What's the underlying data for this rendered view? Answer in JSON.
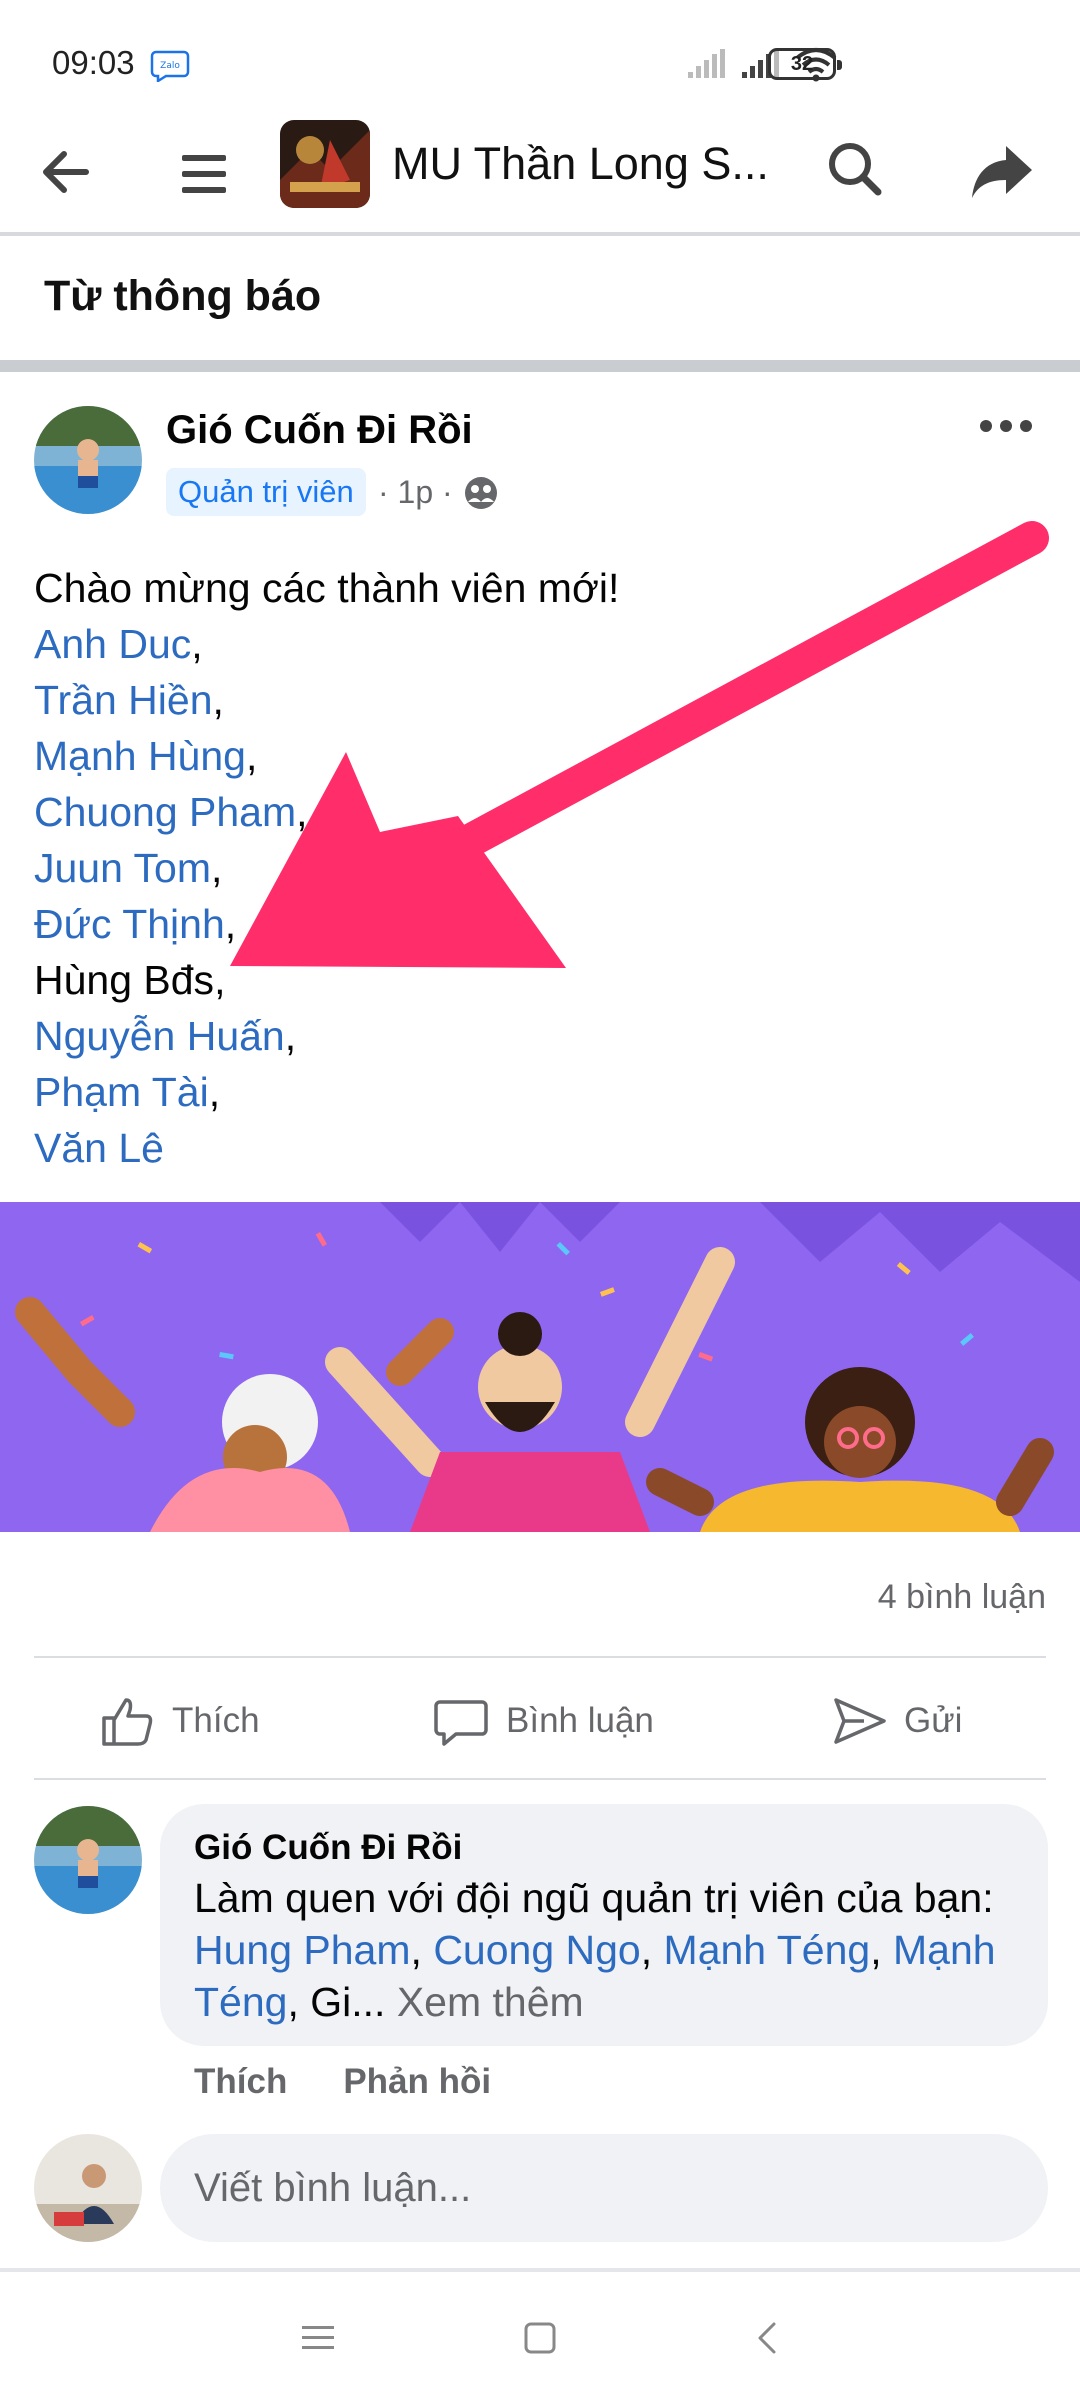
{
  "status_bar": {
    "time": "09:03",
    "app_icon": "zalo-icon",
    "battery": "32"
  },
  "header": {
    "group_name": "MU Thần Long S...",
    "icons": [
      "back-arrow-icon",
      "menu-icon",
      "search-icon",
      "share-icon"
    ]
  },
  "section_label": "Từ thông báo",
  "post": {
    "author": "Gió Cuốn Đi Rồi",
    "role": "Quản trị viên",
    "time": "· 1p ·",
    "intro": "Chào mừng các thành viên mới!",
    "members": [
      {
        "name": "Anh Duc",
        "sep": ",",
        "linked": true
      },
      {
        "name": "Trần Hiền",
        "sep": ",",
        "linked": true
      },
      {
        "name": "Mạnh Hùng",
        "sep": ",",
        "linked": true
      },
      {
        "name": "Chuong Pham",
        "sep": ",",
        "linked": true
      },
      {
        "name": "Juun Tom",
        "sep": ",",
        "linked": true
      },
      {
        "name": "Đức Thịnh",
        "sep": ",",
        "linked": true
      },
      {
        "name": "Hùng Bđs",
        "sep": ",",
        "linked": false
      },
      {
        "name": "Nguyễn Huấn",
        "sep": ",",
        "linked": true
      },
      {
        "name": "Phạm Tài",
        "sep": ",",
        "linked": true
      },
      {
        "name": "Văn Lê",
        "sep": "",
        "linked": true
      }
    ],
    "comment_count": "4 bình luận"
  },
  "actions": {
    "like": "Thích",
    "comment": "Bình luận",
    "send": "Gửi"
  },
  "comment": {
    "author": "Gió Cuốn Đi Rồi",
    "text_prefix": "Làm quen với đội ngũ quản trị viên của bạn: ",
    "mention_1": "Hung Pham",
    "mention_2": "Cuong Ngo",
    "mention_3": "Mạnh Téng",
    "mention_4": "Mạnh Téng",
    "text_tail": ", Gi...",
    "see_more": "Xem thêm",
    "like": "Thích",
    "reply": "Phản hồi"
  },
  "composer": {
    "placeholder": "Viết bình luận..."
  },
  "colors": {
    "link": "#2c6bc0",
    "arrow": "#ff2d6a",
    "banner": "#8f66f0",
    "bubble": "#f0f2f5"
  }
}
